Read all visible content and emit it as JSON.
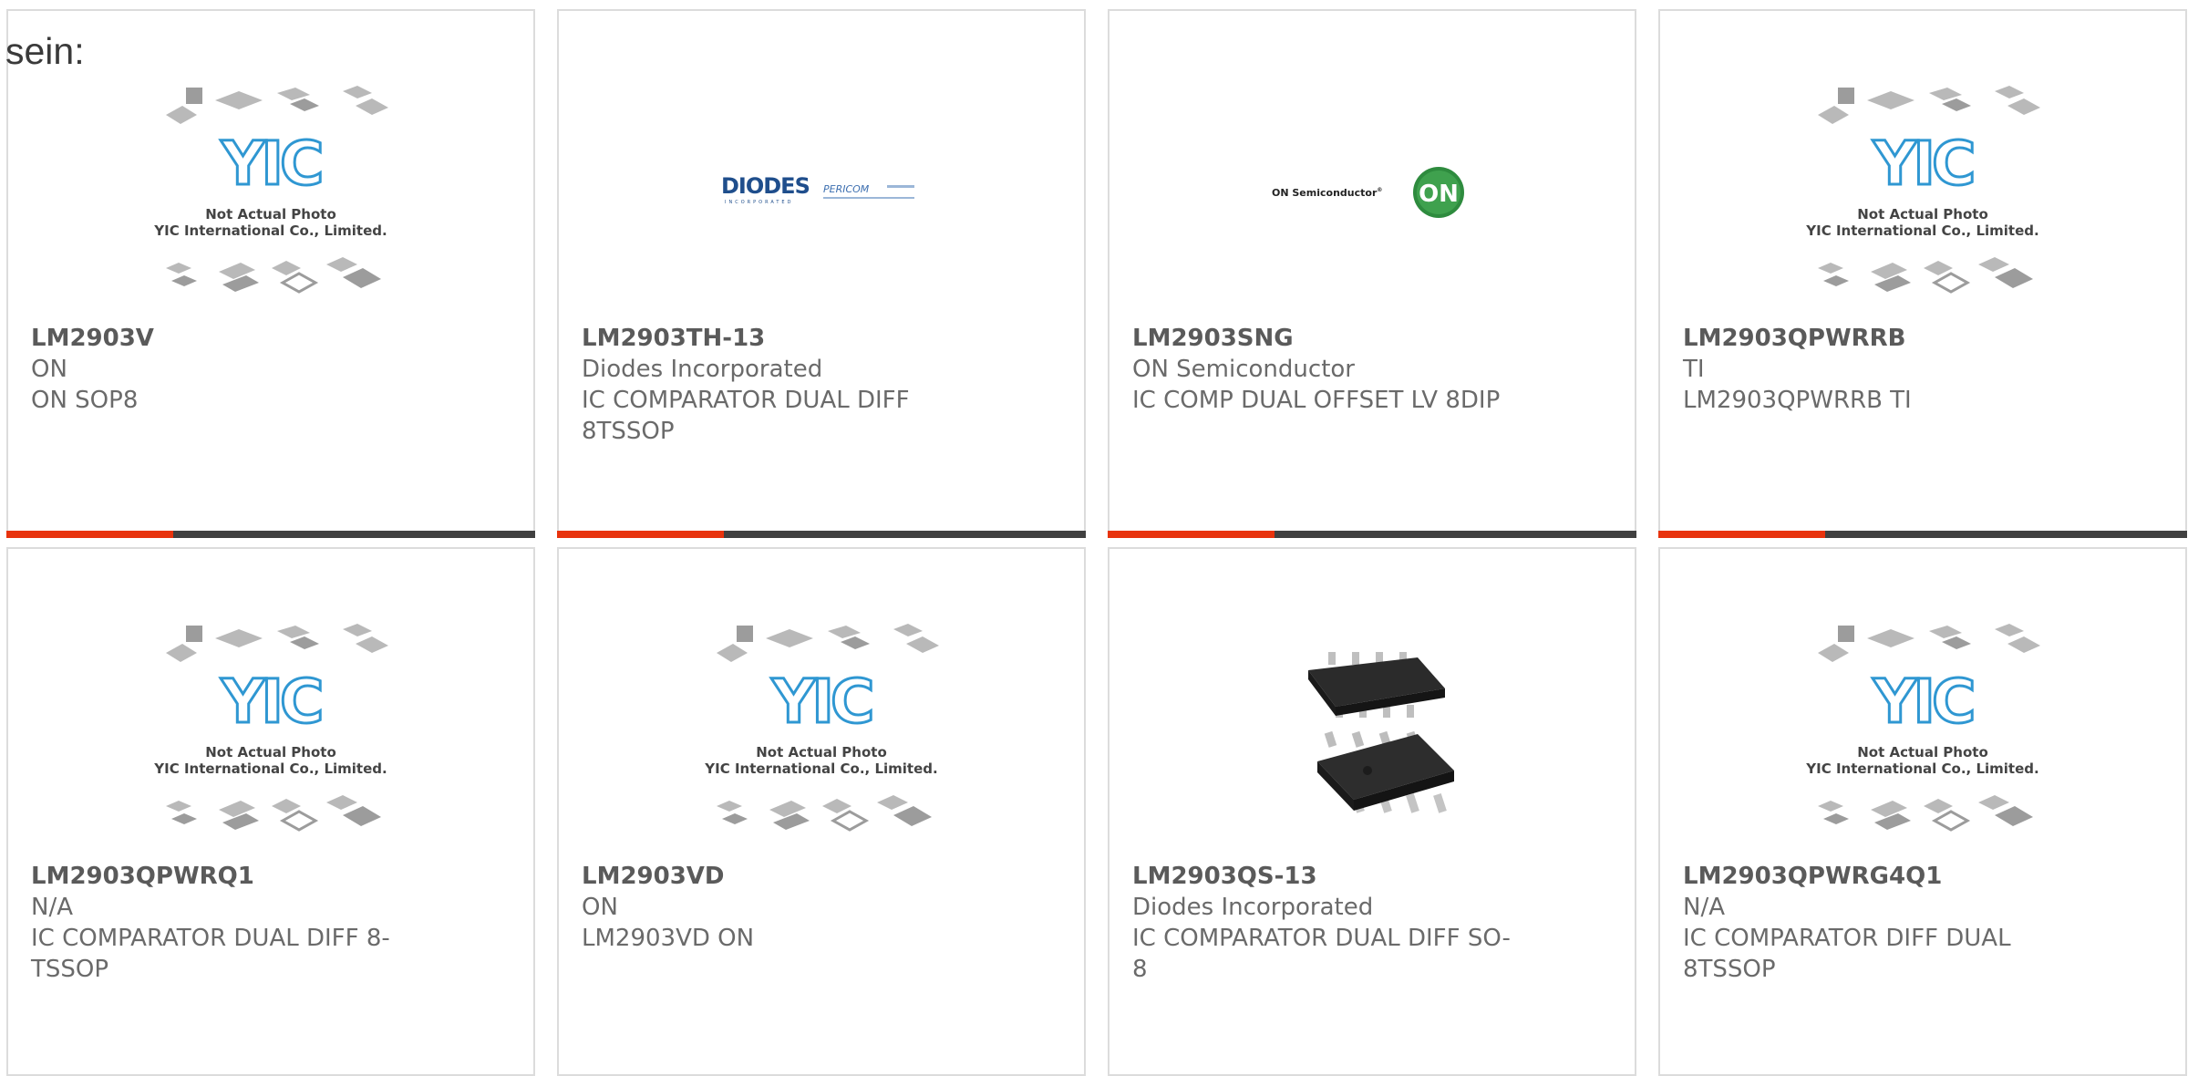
{
  "intro_text": "sein:",
  "colors": {
    "accent": "#e8330d",
    "bar": "#404040",
    "border": "#dcdcdc",
    "yic_blue": "#2f97d2"
  },
  "placeholder": {
    "caption_line1": "Not Actual Photo",
    "caption_line2": "YIC International Co., Limited.",
    "logo_text": "YIC"
  },
  "logos": {
    "diodes": {
      "name": "DIODES",
      "sub": "INCORPORATED",
      "partner": "PERICOM"
    },
    "onsemi": {
      "name": "ON Semiconductor",
      "badge": "ON"
    }
  },
  "products": [
    {
      "part": "LM2903V",
      "manufacturer": "ON",
      "description": "ON SOP8",
      "image": "yic-placeholder"
    },
    {
      "part": "LM2903TH-13",
      "manufacturer": "Diodes Incorporated",
      "description": "IC COMPARATOR DUAL DIFF 8TSSOP",
      "image": "diodes-logo"
    },
    {
      "part": "LM2903SNG",
      "manufacturer": "ON Semiconductor",
      "description": "IC COMP DUAL OFFSET LV 8DIP",
      "image": "onsemi-logo"
    },
    {
      "part": "LM2903QPWRRB",
      "manufacturer": "TI",
      "description": "LM2903QPWRRB TI",
      "image": "yic-placeholder"
    },
    {
      "part": "LM2903QPWRQ1",
      "manufacturer": "N/A",
      "description": "IC COMPARATOR DUAL DIFF 8-TSSOP",
      "image": "yic-placeholder"
    },
    {
      "part": "LM2903VD",
      "manufacturer": "ON",
      "description": "LM2903VD ON",
      "image": "yic-placeholder"
    },
    {
      "part": "LM2903QS-13",
      "manufacturer": "Diodes Incorporated",
      "description": "IC COMPARATOR DUAL DIFF SO-8",
      "image": "so8-chip-photo"
    },
    {
      "part": "LM2903QPWRG4Q1",
      "manufacturer": "N/A",
      "description": "IC COMPARATOR DIFF DUAL 8TSSOP",
      "image": "yic-placeholder"
    }
  ]
}
